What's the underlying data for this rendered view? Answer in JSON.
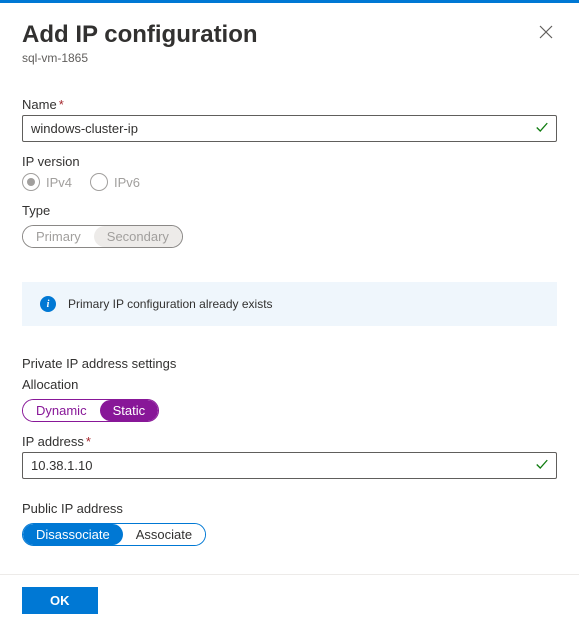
{
  "header": {
    "title": "Add IP configuration",
    "subtitle": "sql-vm-1865"
  },
  "fields": {
    "name": {
      "label": "Name",
      "value": "windows-cluster-ip"
    },
    "ip_version": {
      "label": "IP version",
      "options": {
        "ipv4": "IPv4",
        "ipv6": "IPv6"
      }
    },
    "type": {
      "label": "Type",
      "options": {
        "primary": "Primary",
        "secondary": "Secondary"
      }
    }
  },
  "infobox": {
    "message": "Primary IP configuration already exists"
  },
  "private_ip": {
    "section": "Private IP address settings",
    "allocation": {
      "label": "Allocation",
      "options": {
        "dynamic": "Dynamic",
        "static": "Static"
      }
    },
    "address": {
      "label": "IP address",
      "value": "10.38.1.10"
    }
  },
  "public_ip": {
    "label": "Public IP address",
    "options": {
      "disassociate": "Disassociate",
      "associate": "Associate"
    }
  },
  "footer": {
    "ok": "OK"
  }
}
